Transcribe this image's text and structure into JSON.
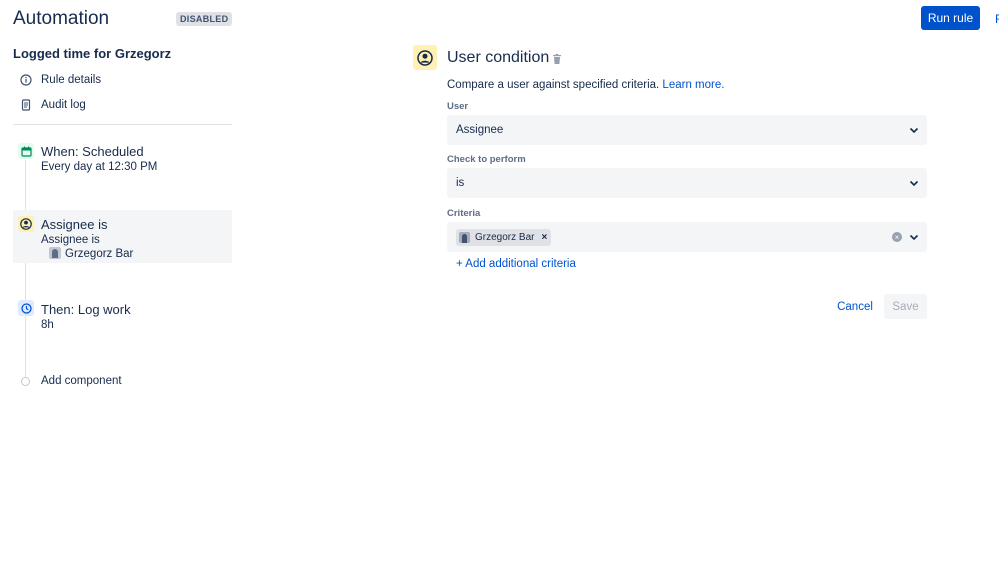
{
  "header": {
    "title": "Automation",
    "status_badge": "DISABLED",
    "run_rule_label": "Run rule",
    "cut_off_link": "R"
  },
  "sidebar": {
    "rule_name": "Logged time for Grzegorz",
    "nav": [
      {
        "label": "Rule details",
        "icon": "info-icon"
      },
      {
        "label": "Audit log",
        "icon": "document-icon"
      }
    ],
    "steps": [
      {
        "title": "When: Scheduled",
        "subtitle": "Every day at 12:30 PM",
        "icon": "calendar-icon",
        "icon_color": "#36b37e"
      },
      {
        "title": "Assignee is",
        "subtitle": "Assignee is",
        "user": "Grzegorz Bar",
        "icon": "user-icon",
        "icon_color": "#ffc400",
        "selected": true
      },
      {
        "title": "Then: Log work",
        "subtitle": "8h",
        "icon": "clock-icon",
        "icon_color": "#0065ff"
      }
    ],
    "add_component_label": "Add component"
  },
  "panel": {
    "title": "User condition",
    "description": "Compare a user against specified criteria.",
    "learn_more": "Learn more.",
    "fields": {
      "user": {
        "label": "User",
        "value": "Assignee"
      },
      "check": {
        "label": "Check to perform",
        "value": "is"
      },
      "criteria": {
        "label": "Criteria",
        "chip": "Grzegorz Bar"
      }
    },
    "add_criteria_label": "+ Add additional criteria",
    "cancel_label": "Cancel",
    "save_label": "Save"
  },
  "colors": {
    "primary": "#0052cc",
    "text": "#172b4d",
    "subtle_bg": "#f4f5f7",
    "condition_yellow": "#fff0b3"
  }
}
